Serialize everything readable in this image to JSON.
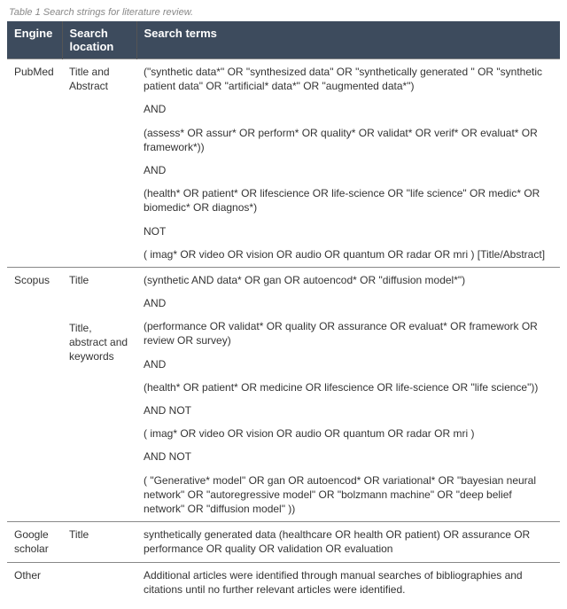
{
  "caption": "Table 1 Search strings for literature review.",
  "headers": {
    "engine": "Engine",
    "location": "Search location",
    "terms": "Search terms"
  },
  "pubmed": {
    "engine": "PubMed",
    "location": "Title and Abstract",
    "p1": "(\"synthetic data*\" OR \"synthesized data\" OR \"synthetically generated \" OR \"synthetic patient data\" OR \"artificial* data*\" OR \"augmented data*\")",
    "and1": "AND",
    "p2": "(assess* OR assur* OR perform* OR quality* OR validat* OR verif* OR evaluat* OR framework*))",
    "and2": "AND",
    "p3": "(health* OR patient* OR lifescience OR life-science OR \"life science\" OR medic* OR biomedic* OR diagnos*)",
    "not": "NOT",
    "p4": "( imag* OR video OR vision OR audio OR quantum OR radar OR mri ) [Title/Abstract]"
  },
  "scopus": {
    "engine": "Scopus",
    "loc1": "Title",
    "loc2": "Title, abstract and keywords",
    "p1": "(synthetic AND data* OR gan OR autoencod* OR \"diffusion model*\")",
    "and1": "AND",
    "p2": "(performance OR validat* OR quality OR assurance OR evaluat* OR framework OR review OR  survey)",
    "and2": "AND",
    "p3": "(health* OR patient* OR medicine OR lifescience OR life-science OR \"life science\"))",
    "andnot1": "AND NOT",
    "p4": "( imag*  OR  video  OR  vision  OR  audio  OR  quantum  OR  radar  OR  mri )",
    "andnot2": "AND NOT",
    "p5": "( \"Generative* model\" OR gan OR autoencod* OR variational* OR \"bayesian neural network\"  OR \"autoregressive model\" OR \"bolzmann machine\" OR \"deep belief network\"  OR \"diffusion model\" ))"
  },
  "google": {
    "engine": "Google scholar",
    "location": "Title",
    "terms": "synthetically generated data (healthcare OR health OR patient) OR assurance OR performance OR quality OR validation OR evaluation"
  },
  "other": {
    "engine": "Other",
    "location": "",
    "terms": "Additional articles were identified through manual searches of bibliographies and citations until no further relevant articles were identified."
  }
}
